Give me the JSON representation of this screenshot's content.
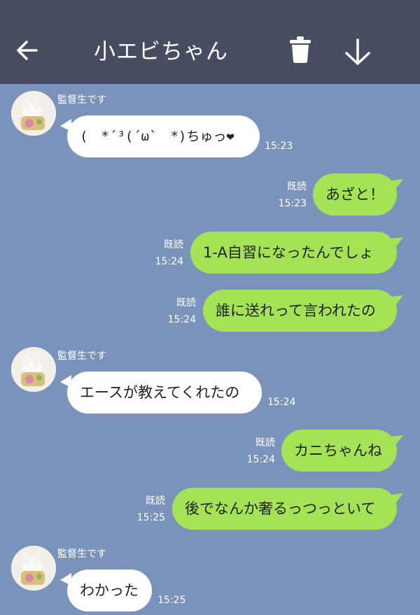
{
  "header": {
    "title": "小エビちゃん",
    "background": "#464d61",
    "icons": [
      "back-arrow-icon",
      "trash-icon",
      "download-arrow-icon"
    ]
  },
  "colors": {
    "chat_background": "#7b93bb",
    "incoming_bubble": "#ffffff",
    "outgoing_bubble": "#a5e356"
  },
  "messages": [
    {
      "direction": "in",
      "sender": "監督生です",
      "text": "(　*´³(´ω`　*)ちゅっ❤",
      "time": "15:23"
    },
    {
      "direction": "out",
      "read": "既読",
      "text": "あざと！",
      "time": "15:23"
    },
    {
      "direction": "out",
      "read": "既読",
      "text": "1-A自習になったんでしょ",
      "time": "15:24"
    },
    {
      "direction": "out",
      "read": "既読",
      "text": "誰に送れって言われたの",
      "time": "15:24"
    },
    {
      "direction": "in",
      "sender": "監督生です",
      "text": "エースが教えてくれたの",
      "time": "15:24"
    },
    {
      "direction": "out",
      "read": "既読",
      "text": "カニちゃんね",
      "time": "15:24"
    },
    {
      "direction": "out",
      "read": "既読",
      "text": "後でなんか奢るっつっといて",
      "time": "15:25"
    },
    {
      "direction": "in",
      "sender": "監督生です",
      "text": "わかった",
      "time": "15:25"
    }
  ]
}
